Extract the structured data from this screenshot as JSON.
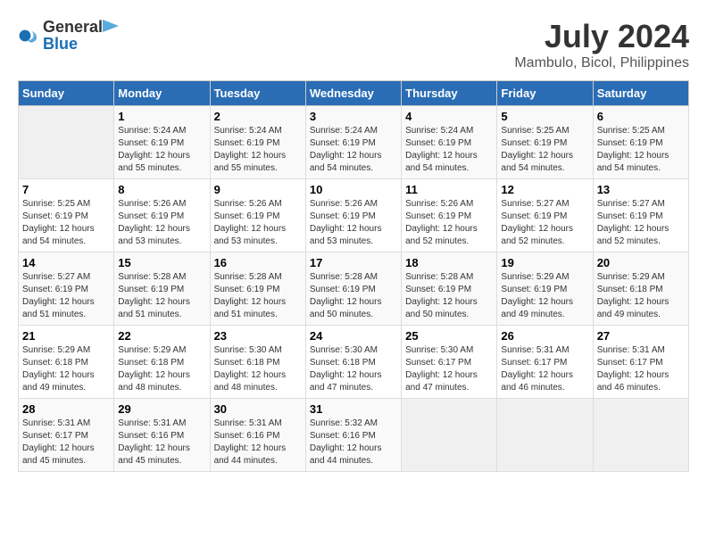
{
  "header": {
    "logo_line1": "General",
    "logo_line2": "Blue",
    "month_year": "July 2024",
    "location": "Mambulo, Bicol, Philippines"
  },
  "calendar": {
    "headers": [
      "Sunday",
      "Monday",
      "Tuesday",
      "Wednesday",
      "Thursday",
      "Friday",
      "Saturday"
    ],
    "weeks": [
      [
        {
          "day": "",
          "info": ""
        },
        {
          "day": "1",
          "info": "Sunrise: 5:24 AM\nSunset: 6:19 PM\nDaylight: 12 hours\nand 55 minutes."
        },
        {
          "day": "2",
          "info": "Sunrise: 5:24 AM\nSunset: 6:19 PM\nDaylight: 12 hours\nand 55 minutes."
        },
        {
          "day": "3",
          "info": "Sunrise: 5:24 AM\nSunset: 6:19 PM\nDaylight: 12 hours\nand 54 minutes."
        },
        {
          "day": "4",
          "info": "Sunrise: 5:24 AM\nSunset: 6:19 PM\nDaylight: 12 hours\nand 54 minutes."
        },
        {
          "day": "5",
          "info": "Sunrise: 5:25 AM\nSunset: 6:19 PM\nDaylight: 12 hours\nand 54 minutes."
        },
        {
          "day": "6",
          "info": "Sunrise: 5:25 AM\nSunset: 6:19 PM\nDaylight: 12 hours\nand 54 minutes."
        }
      ],
      [
        {
          "day": "7",
          "info": "Sunrise: 5:25 AM\nSunset: 6:19 PM\nDaylight: 12 hours\nand 54 minutes."
        },
        {
          "day": "8",
          "info": "Sunrise: 5:26 AM\nSunset: 6:19 PM\nDaylight: 12 hours\nand 53 minutes."
        },
        {
          "day": "9",
          "info": "Sunrise: 5:26 AM\nSunset: 6:19 PM\nDaylight: 12 hours\nand 53 minutes."
        },
        {
          "day": "10",
          "info": "Sunrise: 5:26 AM\nSunset: 6:19 PM\nDaylight: 12 hours\nand 53 minutes."
        },
        {
          "day": "11",
          "info": "Sunrise: 5:26 AM\nSunset: 6:19 PM\nDaylight: 12 hours\nand 52 minutes."
        },
        {
          "day": "12",
          "info": "Sunrise: 5:27 AM\nSunset: 6:19 PM\nDaylight: 12 hours\nand 52 minutes."
        },
        {
          "day": "13",
          "info": "Sunrise: 5:27 AM\nSunset: 6:19 PM\nDaylight: 12 hours\nand 52 minutes."
        }
      ],
      [
        {
          "day": "14",
          "info": "Sunrise: 5:27 AM\nSunset: 6:19 PM\nDaylight: 12 hours\nand 51 minutes."
        },
        {
          "day": "15",
          "info": "Sunrise: 5:28 AM\nSunset: 6:19 PM\nDaylight: 12 hours\nand 51 minutes."
        },
        {
          "day": "16",
          "info": "Sunrise: 5:28 AM\nSunset: 6:19 PM\nDaylight: 12 hours\nand 51 minutes."
        },
        {
          "day": "17",
          "info": "Sunrise: 5:28 AM\nSunset: 6:19 PM\nDaylight: 12 hours\nand 50 minutes."
        },
        {
          "day": "18",
          "info": "Sunrise: 5:28 AM\nSunset: 6:19 PM\nDaylight: 12 hours\nand 50 minutes."
        },
        {
          "day": "19",
          "info": "Sunrise: 5:29 AM\nSunset: 6:19 PM\nDaylight: 12 hours\nand 49 minutes."
        },
        {
          "day": "20",
          "info": "Sunrise: 5:29 AM\nSunset: 6:18 PM\nDaylight: 12 hours\nand 49 minutes."
        }
      ],
      [
        {
          "day": "21",
          "info": "Sunrise: 5:29 AM\nSunset: 6:18 PM\nDaylight: 12 hours\nand 49 minutes."
        },
        {
          "day": "22",
          "info": "Sunrise: 5:29 AM\nSunset: 6:18 PM\nDaylight: 12 hours\nand 48 minutes."
        },
        {
          "day": "23",
          "info": "Sunrise: 5:30 AM\nSunset: 6:18 PM\nDaylight: 12 hours\nand 48 minutes."
        },
        {
          "day": "24",
          "info": "Sunrise: 5:30 AM\nSunset: 6:18 PM\nDaylight: 12 hours\nand 47 minutes."
        },
        {
          "day": "25",
          "info": "Sunrise: 5:30 AM\nSunset: 6:17 PM\nDaylight: 12 hours\nand 47 minutes."
        },
        {
          "day": "26",
          "info": "Sunrise: 5:31 AM\nSunset: 6:17 PM\nDaylight: 12 hours\nand 46 minutes."
        },
        {
          "day": "27",
          "info": "Sunrise: 5:31 AM\nSunset: 6:17 PM\nDaylight: 12 hours\nand 46 minutes."
        }
      ],
      [
        {
          "day": "28",
          "info": "Sunrise: 5:31 AM\nSunset: 6:17 PM\nDaylight: 12 hours\nand 45 minutes."
        },
        {
          "day": "29",
          "info": "Sunrise: 5:31 AM\nSunset: 6:16 PM\nDaylight: 12 hours\nand 45 minutes."
        },
        {
          "day": "30",
          "info": "Sunrise: 5:31 AM\nSunset: 6:16 PM\nDaylight: 12 hours\nand 44 minutes."
        },
        {
          "day": "31",
          "info": "Sunrise: 5:32 AM\nSunset: 6:16 PM\nDaylight: 12 hours\nand 44 minutes."
        },
        {
          "day": "",
          "info": ""
        },
        {
          "day": "",
          "info": ""
        },
        {
          "day": "",
          "info": ""
        }
      ]
    ]
  }
}
